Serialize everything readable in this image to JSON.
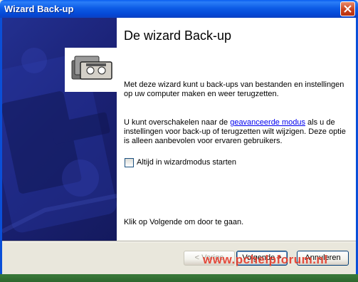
{
  "window": {
    "title": "Wizard Back-up"
  },
  "content": {
    "heading": "De wizard Back-up",
    "para1": "Met deze wizard kunt u back-ups van bestanden en instellingen op uw computer maken en weer terugzetten.",
    "para2_before": "U kunt overschakelen naar de ",
    "para2_link": "geavanceerde modus",
    "para2_after": " als u de instellingen voor back-up of terugzetten wilt wijzigen. Deze optie is alleen aanbevolen voor ervaren gebruikers.",
    "checkbox_label": "Altijd in wizardmodus starten",
    "checkbox_checked": false,
    "footer": "Klik op Volgende om door te gaan."
  },
  "buttons": {
    "back": "< Vorige",
    "next": "Volgende >",
    "cancel": "Annuleren"
  },
  "watermark": "www.pchelpforum.nl",
  "colors": {
    "titlebar": "#0548d6",
    "sidebar": "#1b2276",
    "close": "#c9421e"
  }
}
